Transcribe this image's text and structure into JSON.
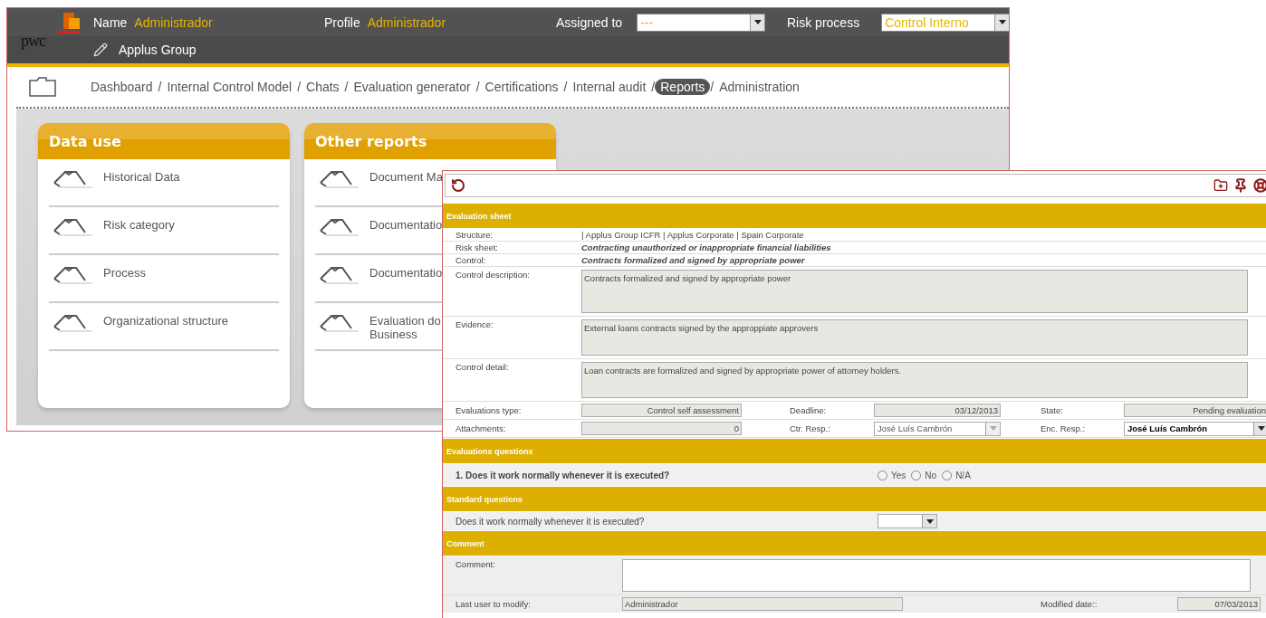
{
  "back_window": {
    "header": {
      "logo_text": "pwc",
      "name_label": "Name",
      "name_value": "Administrador",
      "profile_label": "Profile",
      "profile_value": "Administrador",
      "assigned_label": "Assigned to",
      "assigned_value": "---",
      "risk_label": "Risk process",
      "risk_value": "Control Interno",
      "group": "Applus Group"
    },
    "breadcrumbs": {
      "separator": "/",
      "items": [
        {
          "label": "Dashboard",
          "selected": false
        },
        {
          "label": "Internal Control Model",
          "selected": false
        },
        {
          "label": "Chats",
          "selected": false
        },
        {
          "label": "Evaluation generator",
          "selected": false
        },
        {
          "label": "Certifications",
          "selected": false
        },
        {
          "label": "Internal audit",
          "selected": false
        },
        {
          "label": "Reports",
          "selected": true
        },
        {
          "label": "Administration",
          "selected": false
        }
      ]
    },
    "cards": [
      {
        "title": "Data use",
        "items": [
          {
            "label": "Historical Data"
          },
          {
            "label": "Risk category"
          },
          {
            "label": "Process"
          },
          {
            "label": "Organizational structure"
          }
        ]
      },
      {
        "title": "Other reports",
        "items": [
          {
            "label": "Document Ma"
          },
          {
            "label": "Documentatio"
          },
          {
            "label": "Documentatio"
          },
          {
            "label": "Evaluation do\nBusiness"
          }
        ]
      }
    ]
  },
  "evaluation_window": {
    "evaluation_sheet": {
      "title": "Evaluation sheet",
      "info_rows": [
        {
          "label": "Structure:",
          "value": "| Applus Group ICFR | Applus Corporate | Spain Corporate",
          "kind": "plain"
        },
        {
          "label": "Risk sheet:",
          "value": "Contracting unauthorized or inappropriate financial liabilities",
          "kind": "emphasis"
        },
        {
          "label": "Control:",
          "value": "Contracts formalized and signed by appropriate power",
          "kind": "emphasis"
        }
      ],
      "text_areas": [
        {
          "label": "Control description:",
          "value": "Contracts formalized and signed by appropriate power"
        },
        {
          "label": "Evidence:",
          "value": "External loans contracts signed by the approppiate approvers"
        },
        {
          "label": "Control detail:",
          "value": "Loan contracts are formalized and signed by appropriate power of attorney holders."
        }
      ],
      "field_rows": [
        [
          {
            "label": "Evaluations type:",
            "value": "Control self assessment",
            "kind": "readonly"
          },
          {
            "label": "Deadline:",
            "value": "03/12/2013",
            "kind": "readonly"
          },
          {
            "label": "State:",
            "value": "Pending evaluation",
            "kind": "readonly"
          }
        ],
        [
          {
            "label": "Attachments:",
            "value": "0",
            "kind": "readonly"
          },
          {
            "label": "Ctr. Resp.:",
            "value": "José Luís Cambrón",
            "kind": "select",
            "disabled": true
          },
          {
            "label": "Enc. Resp.:",
            "value": "José Luís Cambrón",
            "kind": "select",
            "disabled": false
          }
        ]
      ]
    },
    "evaluation_questions": {
      "title": "Evaluations questions",
      "questions": [
        {
          "text": "1. Does it work normally whenever it is executed?",
          "options": [
            {
              "label": "Yes",
              "selected": false
            },
            {
              "label": "No",
              "selected": false
            },
            {
              "label": "N/A",
              "selected": false
            }
          ]
        }
      ]
    },
    "standard_questions": {
      "title": "Standard questions",
      "questions": [
        {
          "text": "Does it work normally whenever it is executed?"
        }
      ]
    },
    "comment": {
      "title": "Comment",
      "label": "Comment:",
      "last_user_label": "Last user to modify:",
      "last_user": "Administrador",
      "modified_label": "Modified date::",
      "modified": "07/03/2013"
    }
  }
}
